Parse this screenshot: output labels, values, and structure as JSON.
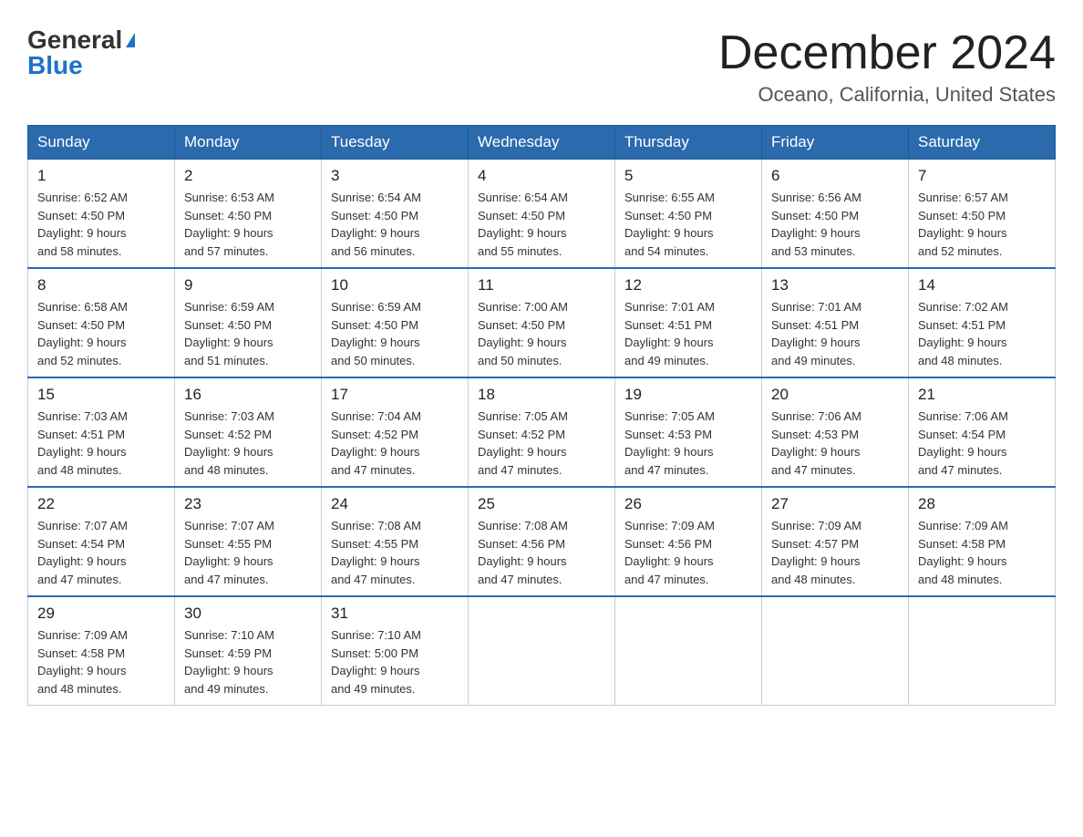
{
  "logo": {
    "general": "General",
    "blue": "Blue"
  },
  "title": "December 2024",
  "location": "Oceano, California, United States",
  "days_header": [
    "Sunday",
    "Monday",
    "Tuesday",
    "Wednesday",
    "Thursday",
    "Friday",
    "Saturday"
  ],
  "weeks": [
    [
      {
        "day": "1",
        "info": "Sunrise: 6:52 AM\nSunset: 4:50 PM\nDaylight: 9 hours\nand 58 minutes."
      },
      {
        "day": "2",
        "info": "Sunrise: 6:53 AM\nSunset: 4:50 PM\nDaylight: 9 hours\nand 57 minutes."
      },
      {
        "day": "3",
        "info": "Sunrise: 6:54 AM\nSunset: 4:50 PM\nDaylight: 9 hours\nand 56 minutes."
      },
      {
        "day": "4",
        "info": "Sunrise: 6:54 AM\nSunset: 4:50 PM\nDaylight: 9 hours\nand 55 minutes."
      },
      {
        "day": "5",
        "info": "Sunrise: 6:55 AM\nSunset: 4:50 PM\nDaylight: 9 hours\nand 54 minutes."
      },
      {
        "day": "6",
        "info": "Sunrise: 6:56 AM\nSunset: 4:50 PM\nDaylight: 9 hours\nand 53 minutes."
      },
      {
        "day": "7",
        "info": "Sunrise: 6:57 AM\nSunset: 4:50 PM\nDaylight: 9 hours\nand 52 minutes."
      }
    ],
    [
      {
        "day": "8",
        "info": "Sunrise: 6:58 AM\nSunset: 4:50 PM\nDaylight: 9 hours\nand 52 minutes."
      },
      {
        "day": "9",
        "info": "Sunrise: 6:59 AM\nSunset: 4:50 PM\nDaylight: 9 hours\nand 51 minutes."
      },
      {
        "day": "10",
        "info": "Sunrise: 6:59 AM\nSunset: 4:50 PM\nDaylight: 9 hours\nand 50 minutes."
      },
      {
        "day": "11",
        "info": "Sunrise: 7:00 AM\nSunset: 4:50 PM\nDaylight: 9 hours\nand 50 minutes."
      },
      {
        "day": "12",
        "info": "Sunrise: 7:01 AM\nSunset: 4:51 PM\nDaylight: 9 hours\nand 49 minutes."
      },
      {
        "day": "13",
        "info": "Sunrise: 7:01 AM\nSunset: 4:51 PM\nDaylight: 9 hours\nand 49 minutes."
      },
      {
        "day": "14",
        "info": "Sunrise: 7:02 AM\nSunset: 4:51 PM\nDaylight: 9 hours\nand 48 minutes."
      }
    ],
    [
      {
        "day": "15",
        "info": "Sunrise: 7:03 AM\nSunset: 4:51 PM\nDaylight: 9 hours\nand 48 minutes."
      },
      {
        "day": "16",
        "info": "Sunrise: 7:03 AM\nSunset: 4:52 PM\nDaylight: 9 hours\nand 48 minutes."
      },
      {
        "day": "17",
        "info": "Sunrise: 7:04 AM\nSunset: 4:52 PM\nDaylight: 9 hours\nand 47 minutes."
      },
      {
        "day": "18",
        "info": "Sunrise: 7:05 AM\nSunset: 4:52 PM\nDaylight: 9 hours\nand 47 minutes."
      },
      {
        "day": "19",
        "info": "Sunrise: 7:05 AM\nSunset: 4:53 PM\nDaylight: 9 hours\nand 47 minutes."
      },
      {
        "day": "20",
        "info": "Sunrise: 7:06 AM\nSunset: 4:53 PM\nDaylight: 9 hours\nand 47 minutes."
      },
      {
        "day": "21",
        "info": "Sunrise: 7:06 AM\nSunset: 4:54 PM\nDaylight: 9 hours\nand 47 minutes."
      }
    ],
    [
      {
        "day": "22",
        "info": "Sunrise: 7:07 AM\nSunset: 4:54 PM\nDaylight: 9 hours\nand 47 minutes."
      },
      {
        "day": "23",
        "info": "Sunrise: 7:07 AM\nSunset: 4:55 PM\nDaylight: 9 hours\nand 47 minutes."
      },
      {
        "day": "24",
        "info": "Sunrise: 7:08 AM\nSunset: 4:55 PM\nDaylight: 9 hours\nand 47 minutes."
      },
      {
        "day": "25",
        "info": "Sunrise: 7:08 AM\nSunset: 4:56 PM\nDaylight: 9 hours\nand 47 minutes."
      },
      {
        "day": "26",
        "info": "Sunrise: 7:09 AM\nSunset: 4:56 PM\nDaylight: 9 hours\nand 47 minutes."
      },
      {
        "day": "27",
        "info": "Sunrise: 7:09 AM\nSunset: 4:57 PM\nDaylight: 9 hours\nand 48 minutes."
      },
      {
        "day": "28",
        "info": "Sunrise: 7:09 AM\nSunset: 4:58 PM\nDaylight: 9 hours\nand 48 minutes."
      }
    ],
    [
      {
        "day": "29",
        "info": "Sunrise: 7:09 AM\nSunset: 4:58 PM\nDaylight: 9 hours\nand 48 minutes."
      },
      {
        "day": "30",
        "info": "Sunrise: 7:10 AM\nSunset: 4:59 PM\nDaylight: 9 hours\nand 49 minutes."
      },
      {
        "day": "31",
        "info": "Sunrise: 7:10 AM\nSunset: 5:00 PM\nDaylight: 9 hours\nand 49 minutes."
      },
      null,
      null,
      null,
      null
    ]
  ]
}
